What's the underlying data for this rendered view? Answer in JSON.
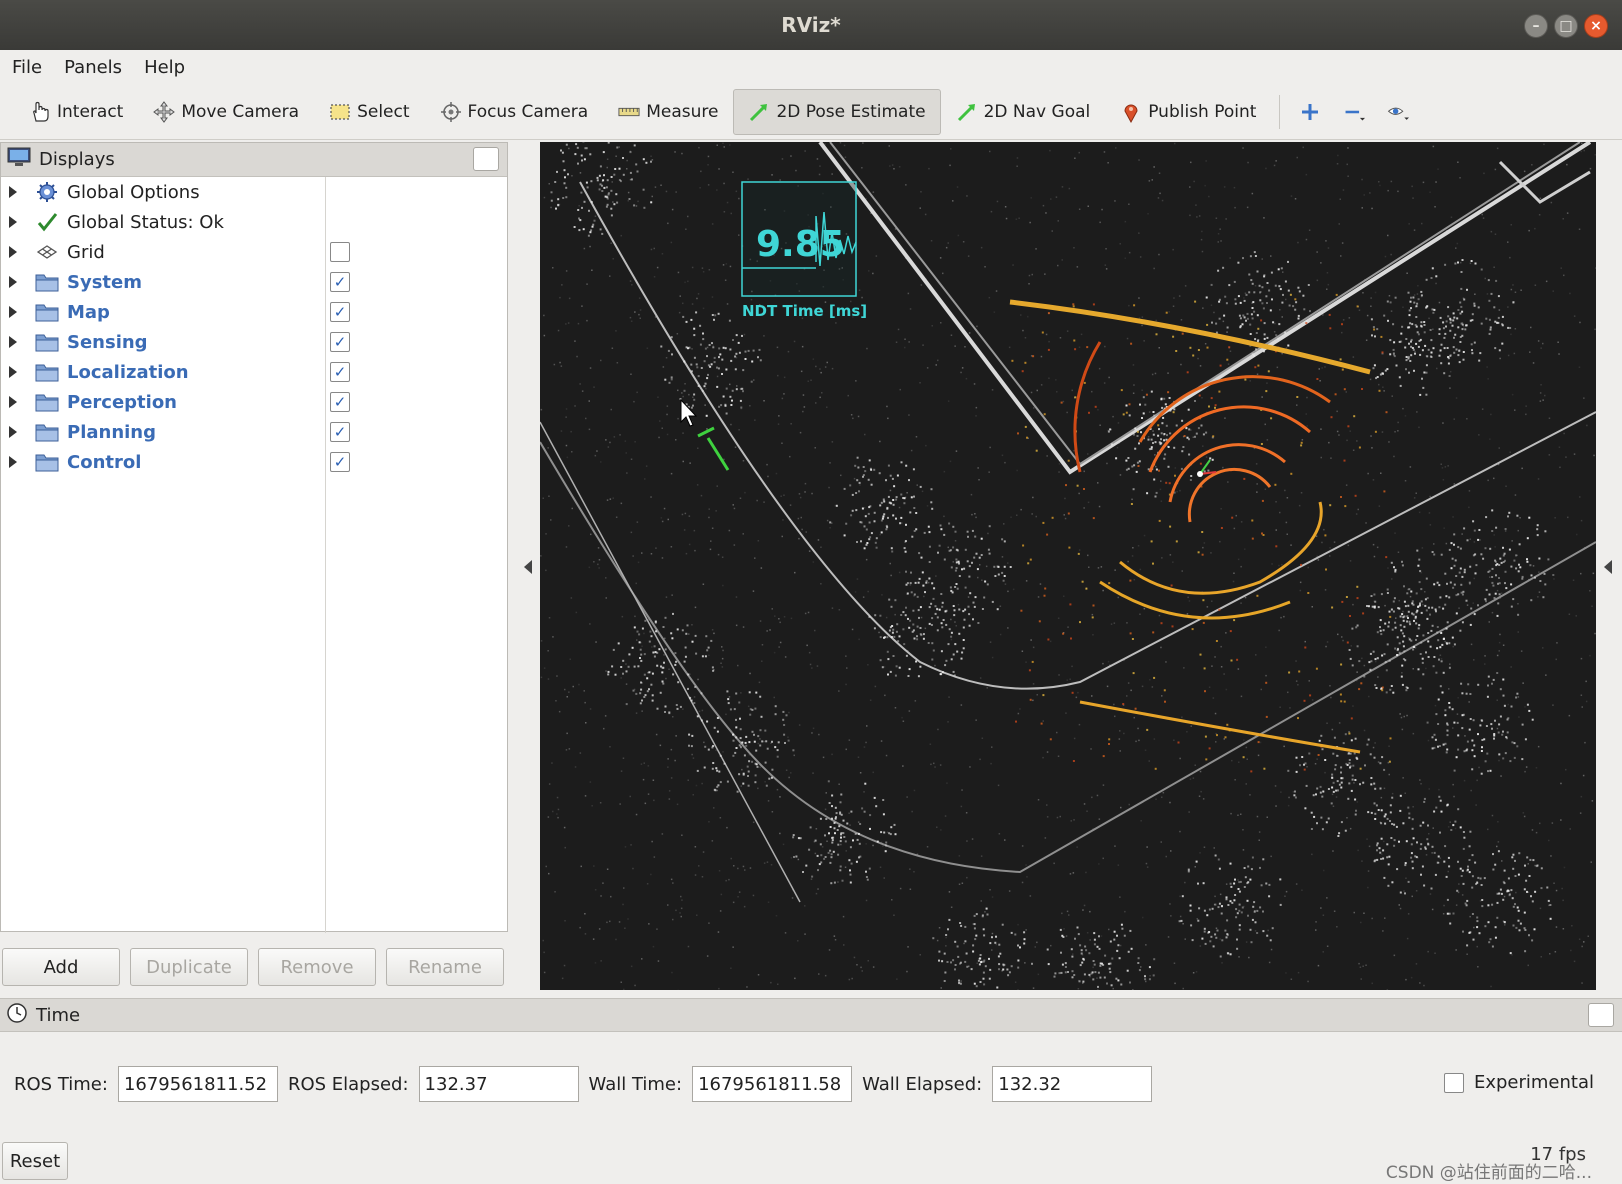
{
  "window": {
    "title": "RViz*"
  },
  "menu": [
    "File",
    "Panels",
    "Help"
  ],
  "toolbar": {
    "interact": "Interact",
    "move_camera": "Move Camera",
    "select": "Select",
    "focus_camera": "Focus Camera",
    "measure": "Measure",
    "pose_estimate": "2D Pose Estimate",
    "nav_goal": "2D Nav Goal",
    "publish_point": "Publish Point"
  },
  "displays": {
    "title": "Displays",
    "items": [
      {
        "label": "Global Options",
        "group": false,
        "checkbox": null
      },
      {
        "label": "Global Status: Ok",
        "group": false,
        "checkbox": null
      },
      {
        "label": "Grid",
        "group": false,
        "checkbox": false
      },
      {
        "label": "System",
        "group": true,
        "checkbox": true
      },
      {
        "label": "Map",
        "group": true,
        "checkbox": true
      },
      {
        "label": "Sensing",
        "group": true,
        "checkbox": true
      },
      {
        "label": "Localization",
        "group": true,
        "checkbox": true
      },
      {
        "label": "Perception",
        "group": true,
        "checkbox": true
      },
      {
        "label": "Planning",
        "group": true,
        "checkbox": true
      },
      {
        "label": "Control",
        "group": true,
        "checkbox": true
      }
    ],
    "buttons": {
      "add": "Add",
      "duplicate": "Duplicate",
      "remove": "Remove",
      "rename": "Rename"
    }
  },
  "overlay": {
    "value": "9.85",
    "label": "NDT Time [ms]",
    "color": "#3fd6d6"
  },
  "time": {
    "title": "Time",
    "ros_time_label": "ROS Time:",
    "ros_time": "1679561811.52",
    "ros_elapsed_label": "ROS Elapsed:",
    "ros_elapsed": "132.37",
    "wall_time_label": "Wall Time:",
    "wall_time": "1679561811.58",
    "wall_elapsed_label": "Wall Elapsed:",
    "wall_elapsed": "132.32",
    "experimental": "Experimental",
    "reset": "Reset",
    "fps": "17 fps"
  },
  "watermark": "CSDN @站住前面的二哈..."
}
